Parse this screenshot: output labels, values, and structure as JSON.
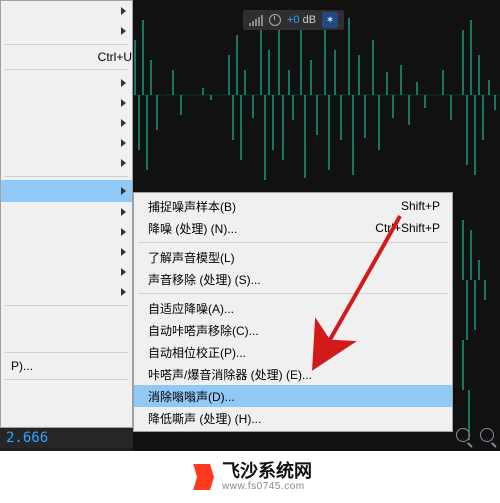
{
  "primary_menu": {
    "shortcut_ctrl_u": "Ctrl+U",
    "p_label": "P)..."
  },
  "submenu": {
    "items": [
      {
        "label": "捕捉噪声样本(B)",
        "shortcut": "Shift+P"
      },
      {
        "label": "降噪 (处理) (N)...",
        "shortcut": "Ctrl+Shift+P"
      }
    ],
    "group2": [
      {
        "label": "了解声音模型(L)"
      },
      {
        "label": "声音移除 (处理) (S)..."
      }
    ],
    "group3": [
      {
        "label": "自适应降噪(A)..."
      },
      {
        "label": "自动咔嗒声移除(C)..."
      },
      {
        "label": "自动相位校正(P)..."
      },
      {
        "label": "咔嗒声/爆音消除器 (处理) (E)..."
      },
      {
        "label": "消除嗡嗡声(D)..."
      },
      {
        "label": "降低嘶声 (处理) (H)..."
      }
    ],
    "selected_index_in_group3": 4
  },
  "hud": {
    "db_value": "+0",
    "db_unit": "dB"
  },
  "timecode": "2.666",
  "watermark": {
    "title": "飞沙系统网",
    "url": "www.fs0745.com"
  }
}
